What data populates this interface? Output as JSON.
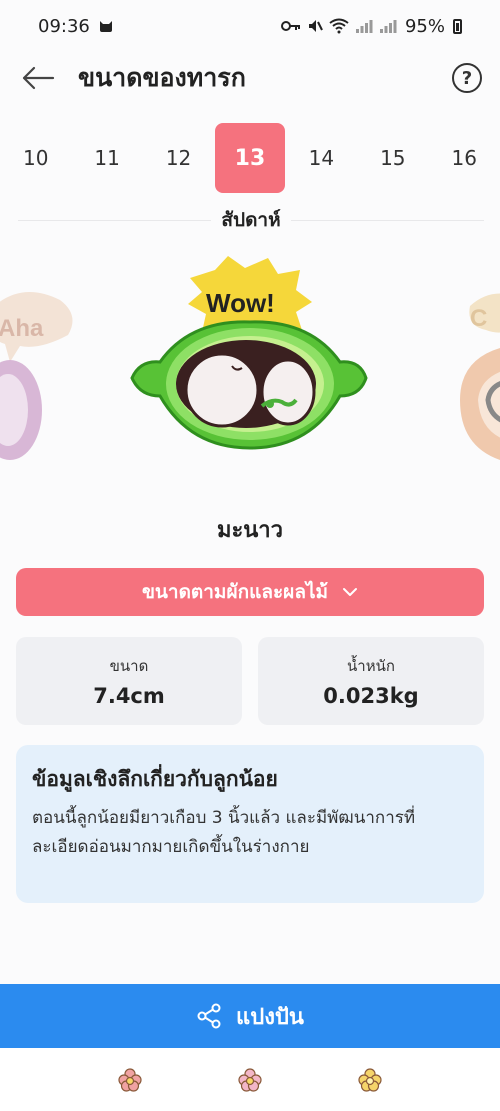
{
  "status_bar": {
    "time": "09:36",
    "battery": "95%"
  },
  "header": {
    "title": "ขนาดของทารก",
    "back_icon": "arrow-left-icon",
    "help_icon": "question-circle-icon",
    "help_glyph": "?"
  },
  "weeks": {
    "items": [
      "10",
      "11",
      "12",
      "13",
      "14",
      "15",
      "16"
    ],
    "selected": "13",
    "caption": "สัปดาห์"
  },
  "carousel": {
    "left_sticker_text": "Aha",
    "center_sticker_text": "Wow!",
    "right_sticker_text": "C"
  },
  "fruit": {
    "name": "มะนาว"
  },
  "compare_button": {
    "label": "ขนาดตามผักและผลไม้"
  },
  "stats": {
    "size_label": "ขนาด",
    "size_value": "7.4cm",
    "weight_label": "น้ำหนัก",
    "weight_value": "0.023kg"
  },
  "insight": {
    "title": "ข้อมูลเชิงลึกเกี่ยวกับลูกน้อย",
    "body": "ตอนนี้ลูกน้อยมียาวเกือบ 3 นิ้วแล้ว และมีพัฒนาการที่ละเอียดอ่อนมากมายเกิดขึ้นในร่างกาย"
  },
  "share": {
    "label": "แปงปัน",
    "icon": "share-icon"
  },
  "bottom_nav": {
    "icons": [
      "flower-icon",
      "flower-icon",
      "flower-icon"
    ]
  },
  "colors": {
    "accent_pink": "#f5727e",
    "share_blue": "#2b8bef",
    "insight_bg": "#e4f0fb",
    "lime_green": "#5ec436"
  }
}
